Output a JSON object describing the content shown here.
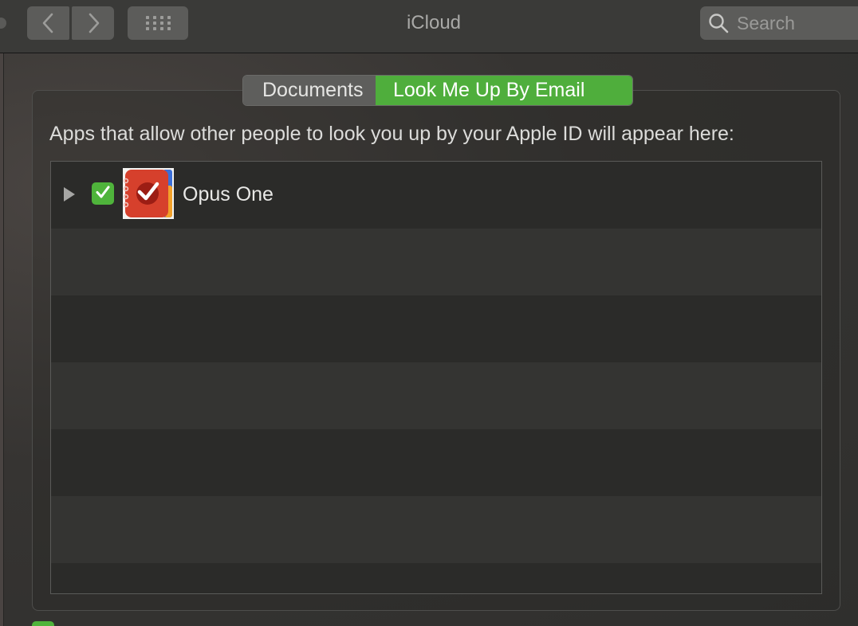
{
  "window": {
    "title": "iCloud"
  },
  "toolbar": {
    "back_icon": "chevron-left-icon",
    "forward_icon": "chevron-right-icon",
    "grid_icon": "grid-icon",
    "search": {
      "placeholder": "Search",
      "icon": "search-icon"
    }
  },
  "tabs": [
    {
      "label": "Documents",
      "selected": false
    },
    {
      "label": "Look Me Up By Email",
      "selected": true
    }
  ],
  "main": {
    "description": "Apps that allow other people to look you up by your Apple ID will appear here:"
  },
  "apps": [
    {
      "name": "Opus One",
      "checked": true,
      "icon": "opus-one-app-icon"
    }
  ],
  "colors": {
    "accent_green": "#4fae3c",
    "checkbox_green": "#4fb43b",
    "app_icon_red": "#d6402c"
  }
}
